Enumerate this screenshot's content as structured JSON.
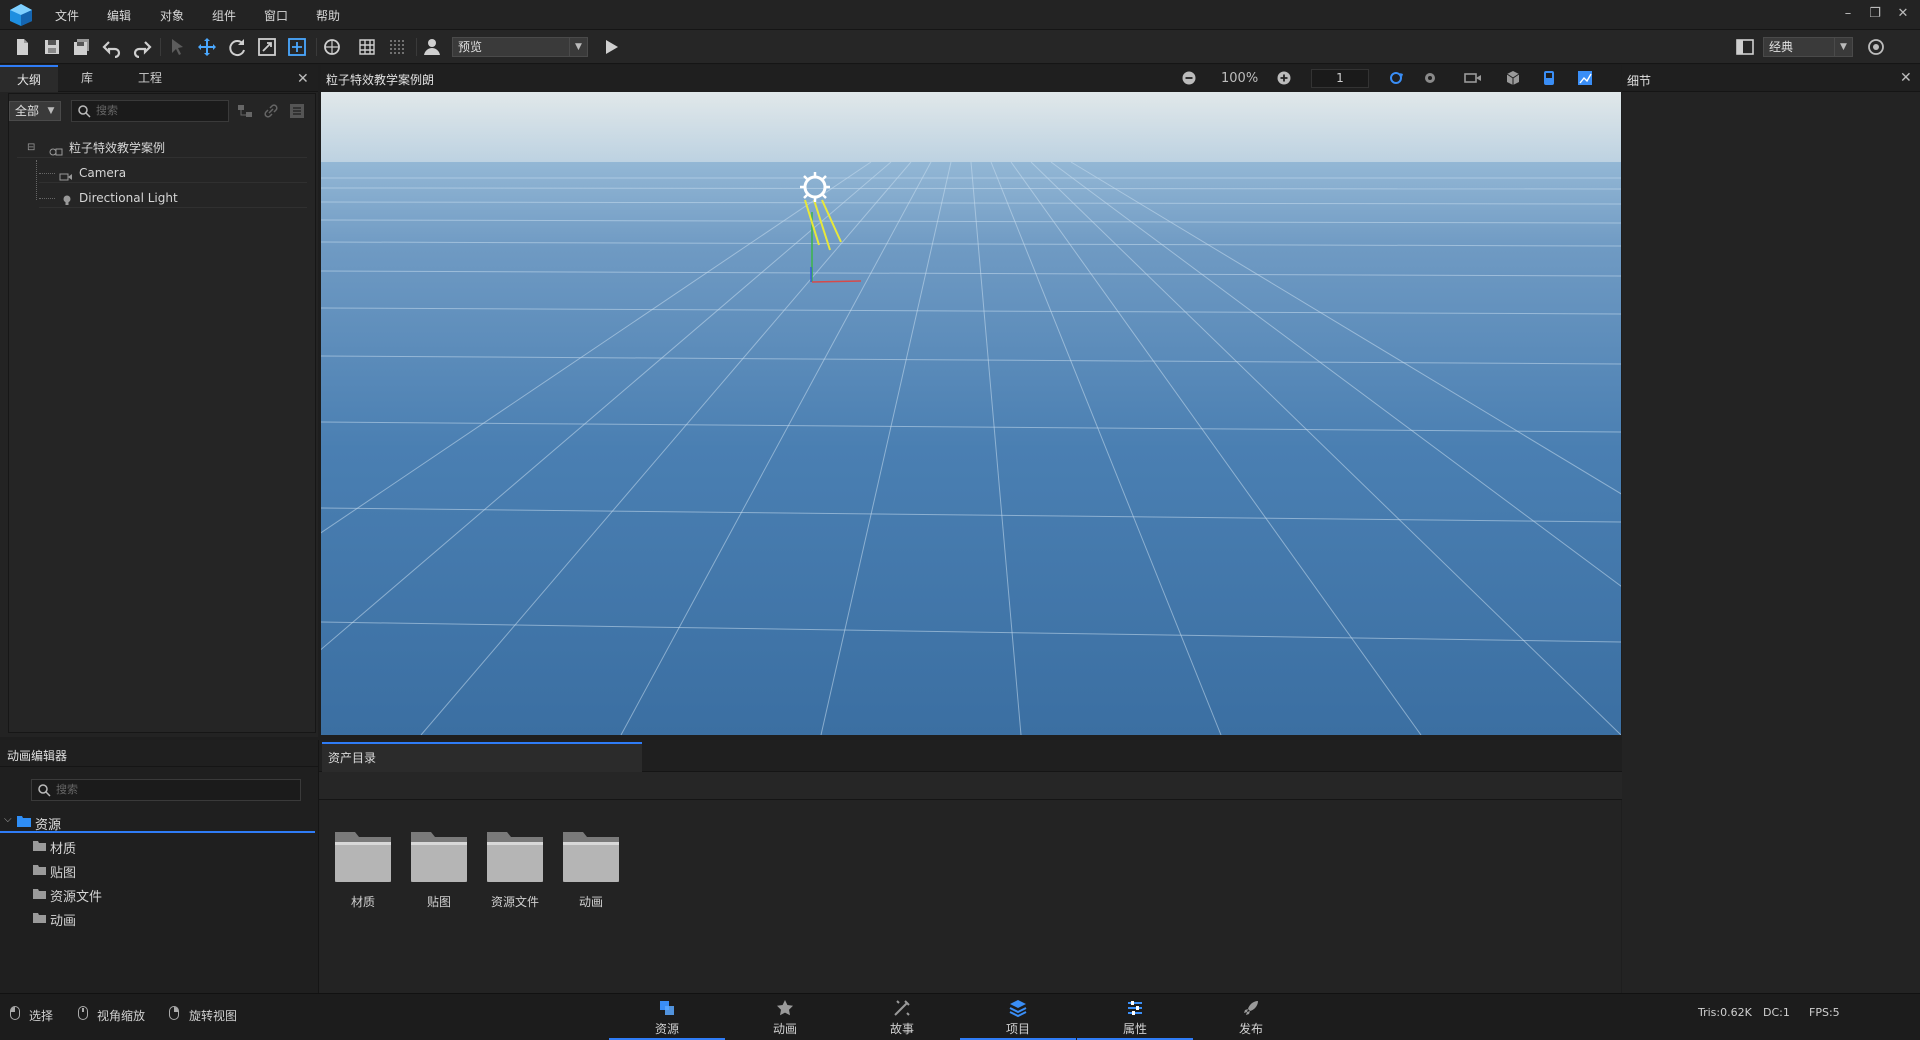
{
  "menu": {
    "items": [
      "文件",
      "编辑",
      "对象",
      "组件",
      "窗口",
      "帮助"
    ]
  },
  "toolbar": {
    "mode_select": "预览",
    "layout_select": "经典"
  },
  "outline_panel": {
    "tabs": [
      "大纲",
      "库",
      "工程"
    ],
    "filter": "全部",
    "search_placeholder": "搜索",
    "tree": {
      "root": "粒子特效教学案例",
      "children": [
        "Camera",
        "Directional Light"
      ]
    }
  },
  "viewport": {
    "title": "粒子特效教学案例朗",
    "zoom": "100%",
    "frame": "1",
    "sky_color": "#c9dbe4",
    "ground_color": "#3d73a6"
  },
  "details_panel": {
    "title": "细节"
  },
  "animation_editor": {
    "title": "动画编辑器",
    "search_placeholder": "搜索",
    "tree": {
      "root": "资源",
      "children": [
        "材质",
        "贴图",
        "资源文件",
        "动画"
      ]
    }
  },
  "asset_panel": {
    "tab": "资产目录",
    "folders": [
      "材质",
      "贴图",
      "资源文件",
      "动画"
    ]
  },
  "status": {
    "hints": [
      "选择",
      "视角缩放",
      "旋转视图"
    ],
    "tris": "Tris:0.62K",
    "dc": "DC:1",
    "fps": "FPS:5"
  },
  "bottom_tabs": [
    {
      "label": "资源",
      "icon": "asset-icon"
    },
    {
      "label": "动画",
      "icon": "animation-icon"
    },
    {
      "label": "故事",
      "icon": "story-icon"
    },
    {
      "label": "项目",
      "icon": "project-icon"
    },
    {
      "label": "属性",
      "icon": "properties-icon"
    },
    {
      "label": "发布",
      "icon": "publish-icon"
    }
  ],
  "colors": {
    "accent": "#2f7cf6",
    "panel": "#262626"
  }
}
